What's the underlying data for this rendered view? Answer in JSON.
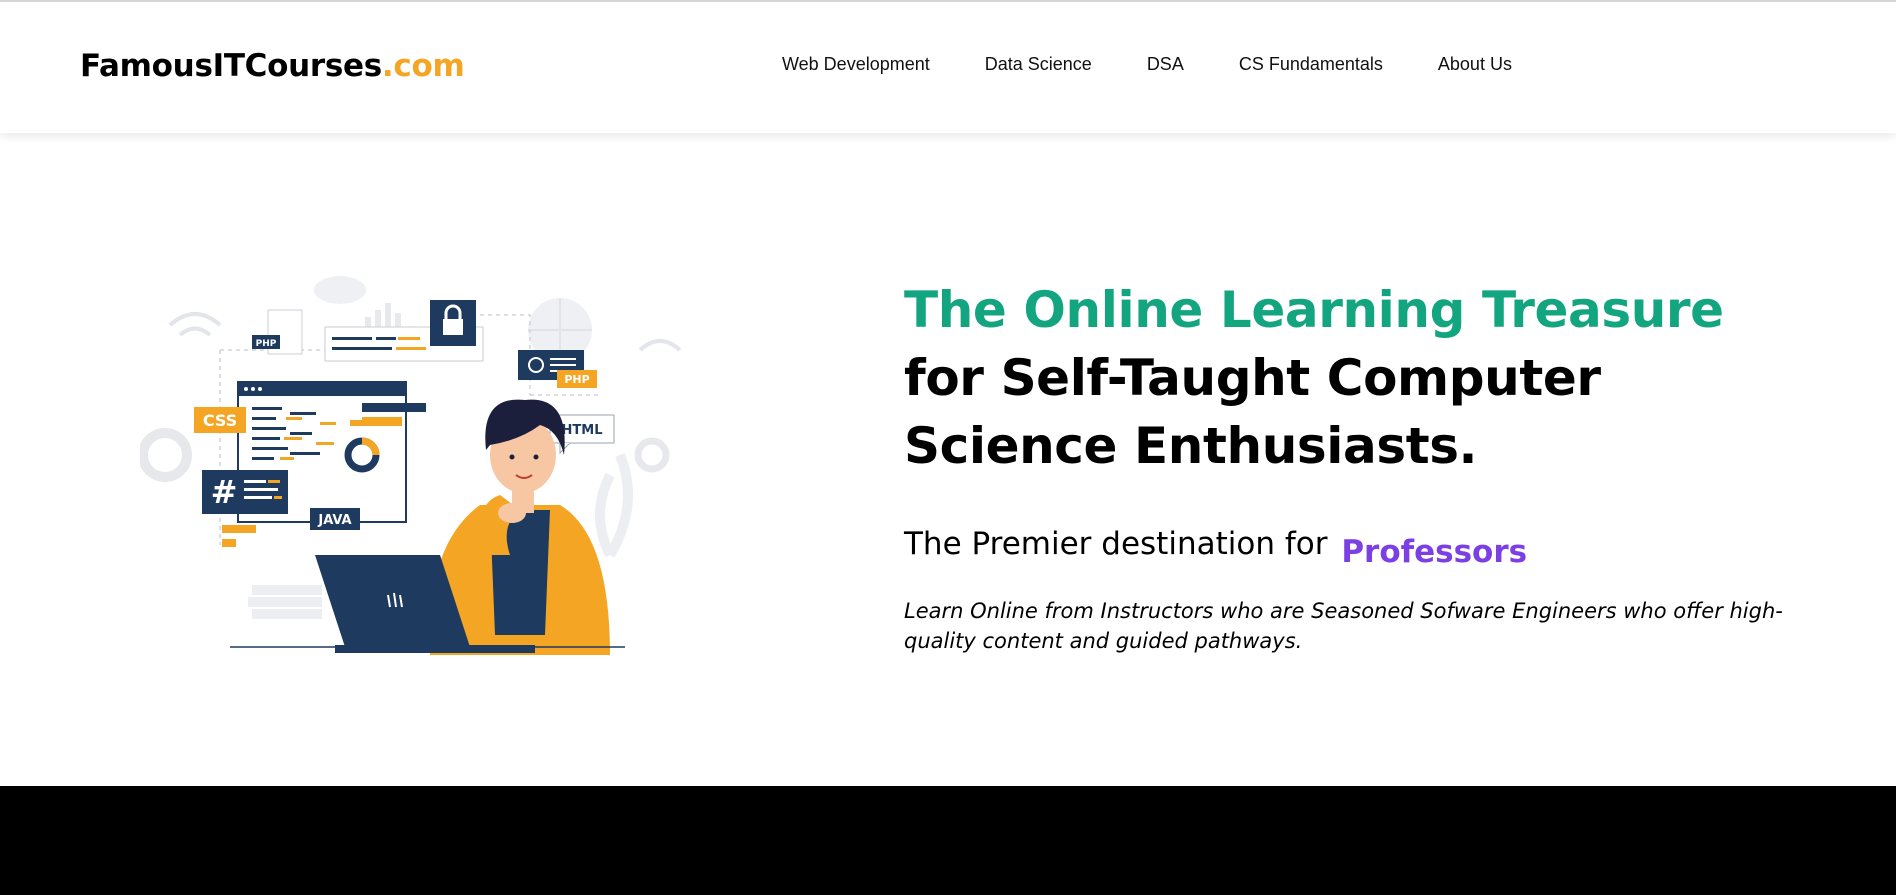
{
  "brand": {
    "name": "FamousITCourses",
    "tld": ".com"
  },
  "nav": {
    "items": [
      {
        "label": "Web Development"
      },
      {
        "label": "Data Science"
      },
      {
        "label": "DSA"
      },
      {
        "label": "CS Fundamentals"
      },
      {
        "label": "About Us"
      }
    ]
  },
  "hero": {
    "headline_accent": "The Online Learning Treasure",
    "headline_rest": " for Self-Taught Computer Science Enthusiasts.",
    "tagline_prefix": "The Premier destination for",
    "tagline_role": "Professors",
    "description": "Learn Online from Instructors who are Seasoned Sofware Engineers who offer high-quality content and guided pathways."
  },
  "illustration": {
    "labels": {
      "css": "CSS",
      "php1": "PHP",
      "php2": "PHP",
      "html": "HTML",
      "java": "JAVA",
      "hash": "#"
    }
  },
  "colors": {
    "accent_green": "#12a57f",
    "accent_orange": "#f5a524",
    "accent_purple": "#7b3fe4",
    "navy": "#1f3a5f"
  }
}
